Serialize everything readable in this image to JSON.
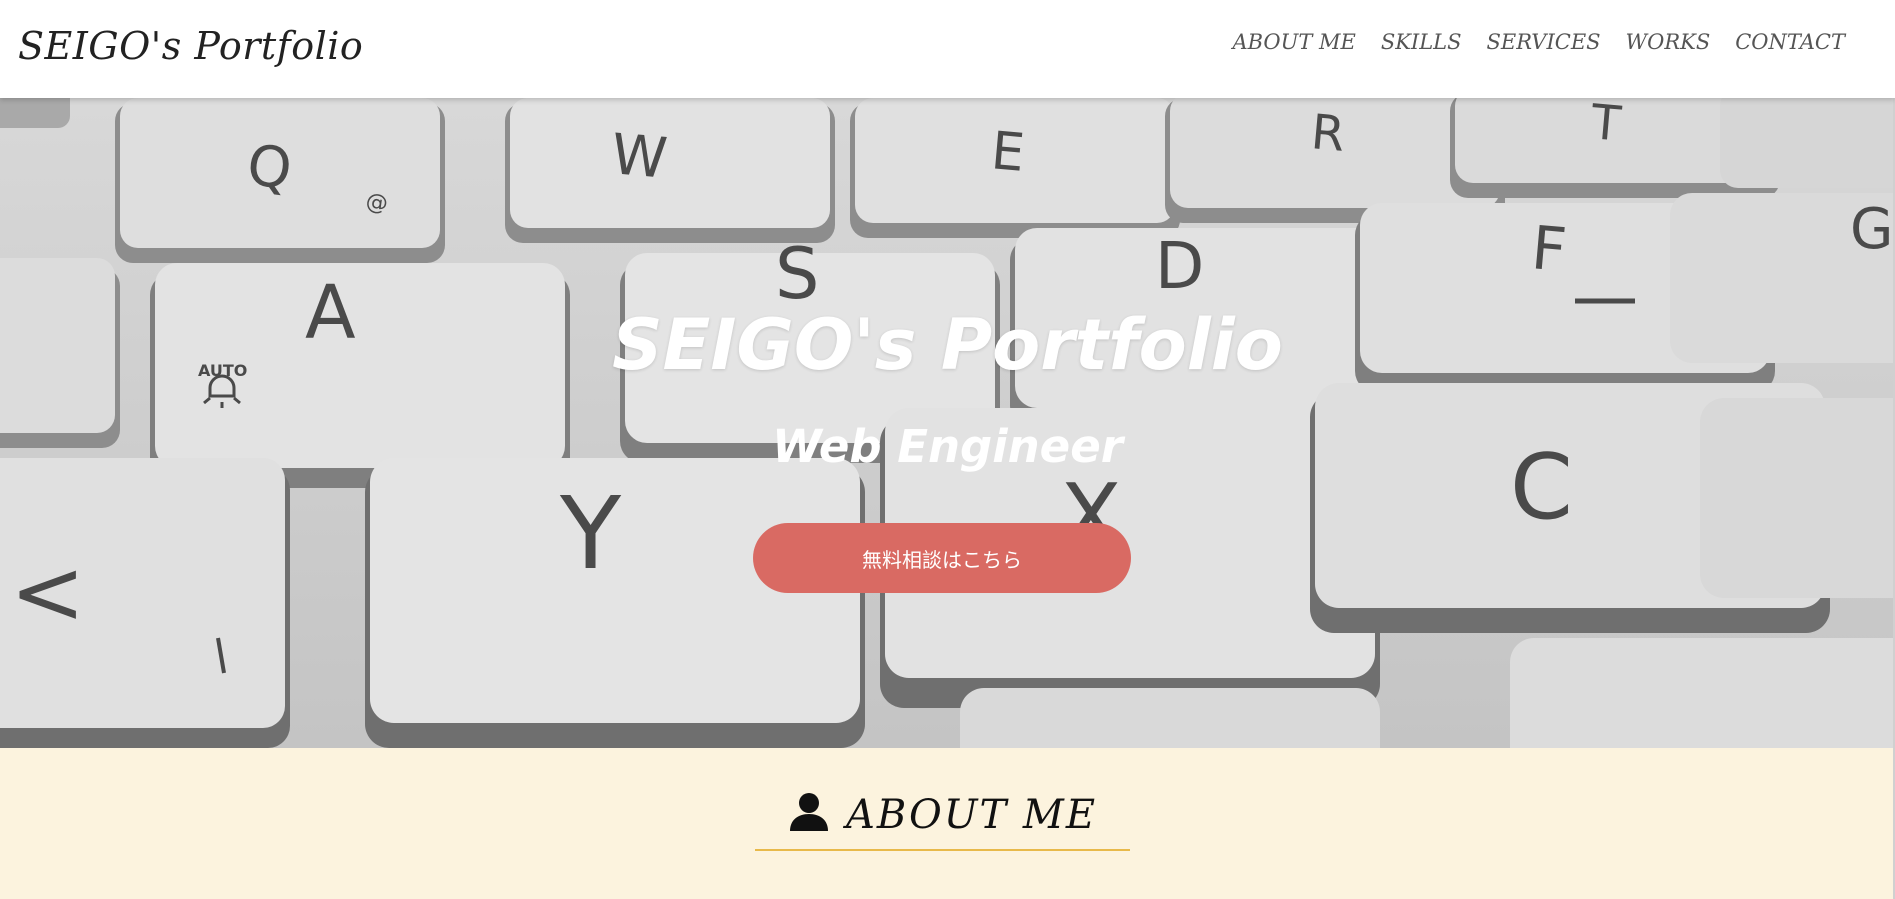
{
  "header": {
    "logo": "SEIGO's Portfolio",
    "nav": [
      "ABOUT ME",
      "SKILLS",
      "SERVICES",
      "WORKS",
      "CONTACT"
    ]
  },
  "hero": {
    "title": "SEIGO's Portfolio",
    "subtitle": "Web Engineer",
    "cta_label": "無料相談はこちら",
    "keys": [
      "Q",
      "W",
      "E",
      "R",
      "T",
      "A",
      "S",
      "D",
      "F",
      "G",
      "Y",
      "X",
      "C",
      "<"
    ],
    "key_marks": [
      "@",
      "AUTO"
    ]
  },
  "about": {
    "title": "ABOUT ME",
    "icon": "user-icon"
  },
  "colors": {
    "cta": "#d96a63",
    "about_bg": "#fcf3de",
    "about_underline": "#e8b94a"
  }
}
